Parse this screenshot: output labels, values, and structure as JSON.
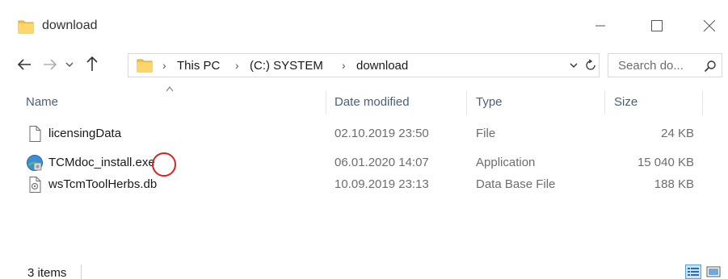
{
  "window": {
    "title": "download",
    "controls": {
      "minimize": "minimize",
      "maximize": "maximize",
      "close": "close"
    }
  },
  "nav": {
    "back_icon": "arrow-left-icon",
    "forward_icon": "arrow-right-icon",
    "recent_icon": "chevron-down-icon",
    "up_icon": "arrow-up-icon"
  },
  "address": {
    "breadcrumbs": [
      "This PC",
      "(C:) SYSTEM",
      "download"
    ],
    "separator": "›"
  },
  "search": {
    "placeholder": "Search do..."
  },
  "columns": {
    "name": "Name",
    "date": "Date modified",
    "type": "Type",
    "size": "Size"
  },
  "files": [
    {
      "name": "licensingData",
      "date": "02.10.2019 23:50",
      "type": "File",
      "size": "24 KB",
      "icon": "blank-file-icon"
    },
    {
      "name": "TCMdoc_install.exe",
      "date": "06.01.2020 14:07",
      "type": "Application",
      "size": "15 040 KB",
      "icon": "installer-app-icon"
    },
    {
      "name": "wsTcmToolHerbs.db",
      "date": "10.09.2019 23:13",
      "type": "Data Base File",
      "size": "188 KB",
      "icon": "database-file-icon"
    }
  ],
  "status": {
    "item_count": "3 items"
  },
  "colors": {
    "folder": "#f4c34d",
    "header_text": "#4c607a",
    "highlight": "#e02020",
    "selected_view": "#cce4f7"
  }
}
